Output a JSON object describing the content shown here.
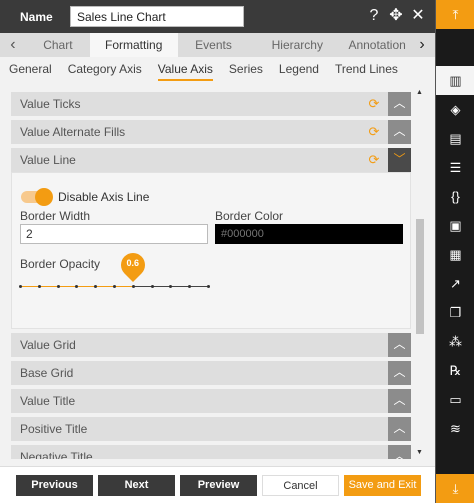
{
  "header": {
    "name_label": "Name",
    "name_value": "Sales Line Chart",
    "icons": [
      "help-icon",
      "move-icon",
      "close-icon"
    ]
  },
  "tabs": {
    "items": [
      "Chart",
      "Formatting",
      "Events",
      "Hierarchy",
      "Annotation"
    ],
    "active": "Formatting"
  },
  "subtabs": {
    "items": [
      "General",
      "Category Axis",
      "Value Axis",
      "Series",
      "Legend",
      "Trend Lines"
    ],
    "active": "Value Axis"
  },
  "sections": {
    "value_ticks": "Value Ticks",
    "value_alternate_fills": "Value Alternate Fills",
    "value_line": "Value Line",
    "value_grid": "Value Grid",
    "base_grid": "Base Grid",
    "value_title": "Value Title",
    "positive_title": "Positive Title",
    "negative_title": "Negative Title"
  },
  "value_line": {
    "toggle_label": "Disable Axis Line",
    "toggle_on": true,
    "border_width_label": "Border Width",
    "border_width_value": "2",
    "border_color_label": "Border Color",
    "border_color_value": "#000000",
    "border_opacity_label": "Border Opacity",
    "border_opacity_value": "0.6"
  },
  "footer": {
    "previous": "Previous",
    "next": "Next",
    "preview": "Preview",
    "cancel": "Cancel",
    "save_exit": "Save and Exit"
  },
  "rightbar": {
    "icons": [
      "collapse-top-icon",
      "chart-icon",
      "map-icon",
      "document-icon",
      "text-doc-icon",
      "code-braces-icon",
      "image-icon",
      "table-icon",
      "line-chart-icon",
      "copy-icon",
      "hierarchy-icon",
      "formula-icon",
      "save-icon",
      "layers-icon",
      "collapse-bottom-icon"
    ]
  },
  "colors": {
    "accent": "#f39c12",
    "header_bg": "#3a3a3a",
    "section_bg": "#dedede",
    "toggle_btn": "#8c8c8c"
  }
}
